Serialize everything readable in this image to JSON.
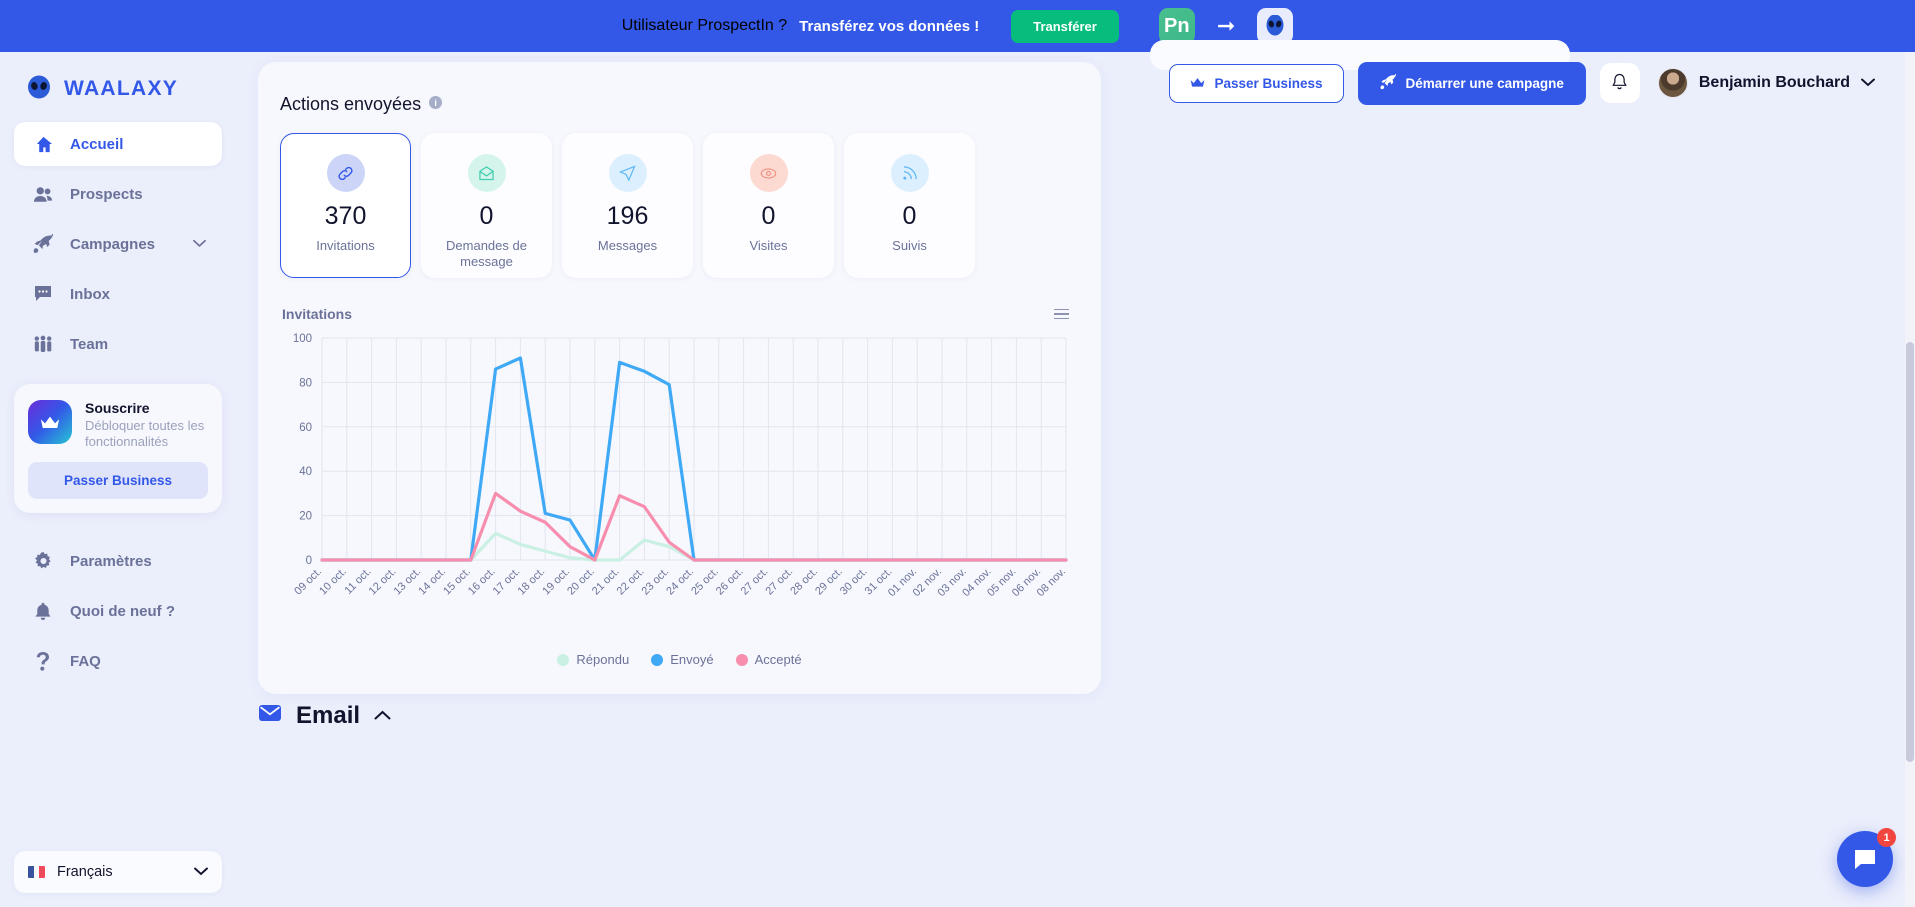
{
  "banner": {
    "title": "Utilisateur ProspectIn ?",
    "subtitle": "Transférez vos données !",
    "button": "Transférer",
    "pn_badge": "Pn",
    "arrow_icon": "arrow-right-icon",
    "alien_icon": "alien-icon",
    "close_icon": "close-icon"
  },
  "sidebar": {
    "brand": "WAALAXY",
    "brand_icon": "alien-logo-icon",
    "items": [
      {
        "label": "Accueil",
        "icon": "home-icon",
        "active": true,
        "chevron": ""
      },
      {
        "label": "Prospects",
        "icon": "users-icon",
        "active": false,
        "chevron": ""
      },
      {
        "label": "Campagnes",
        "icon": "rocket-icon",
        "active": false,
        "chevron": "⌄"
      },
      {
        "label": "Inbox",
        "icon": "chat-icon",
        "active": false,
        "chevron": ""
      },
      {
        "label": "Team",
        "icon": "team-icon",
        "active": false,
        "chevron": ""
      }
    ],
    "promo": {
      "icon": "crown-icon",
      "title": "Souscrire",
      "subtitle": "Débloquer toutes les fonctionnalités",
      "button": "Passer Business"
    },
    "bottom_items": [
      {
        "label": "Paramètres",
        "icon": "gear-icon"
      },
      {
        "label": "Quoi de neuf ?",
        "icon": "bell-icon"
      },
      {
        "label": "FAQ",
        "icon": "question-icon"
      }
    ],
    "language": {
      "label": "Français",
      "flag": "fr-flag-icon",
      "chevron": "⌄"
    }
  },
  "topbar": {
    "upgrade_button": "Passer Business",
    "upgrade_icon": "crown-icon",
    "campaign_button": "Démarrer une campagne",
    "campaign_icon": "rocket-icon",
    "bell_icon": "bell-icon",
    "user_name": "Benjamin Bouchard",
    "user_chevron": "⌄",
    "avatar": "user-avatar"
  },
  "main": {
    "section_title": "Actions envoyées",
    "info_icon": "info-icon",
    "cards": [
      {
        "value": "370",
        "label": "Invitations",
        "icon": "link-icon",
        "icon_bg": "#ccd5f8",
        "icon_color": "#3358e8",
        "selected": true
      },
      {
        "value": "0",
        "label": "Demandes de message",
        "icon": "mail-open-icon",
        "icon_bg": "#d5f5ec",
        "icon_color": "#3fcfae",
        "selected": false
      },
      {
        "value": "196",
        "label": "Messages",
        "icon": "paper-plane-icon",
        "icon_bg": "#dcefff",
        "icon_color": "#5fb8f5",
        "selected": false
      },
      {
        "value": "0",
        "label": "Visites",
        "icon": "eye-icon",
        "icon_bg": "#fcd9d1",
        "icon_color": "#f08e80",
        "selected": false
      },
      {
        "value": "0",
        "label": "Suivis",
        "icon": "rss-icon",
        "icon_bg": "#dcefff",
        "icon_color": "#5fb8f5",
        "selected": false
      }
    ],
    "chart_heading": "Invitations",
    "menu_icon": "hamburger-menu-icon",
    "email_section": {
      "icon": "email-icon",
      "title": "Email",
      "chevron": "⌃"
    }
  },
  "chat": {
    "icon": "chat-bubble-icon",
    "badge": "1"
  },
  "chart_data": {
    "type": "line",
    "title": "Invitations",
    "xlabel": "",
    "ylabel": "",
    "ylim": [
      0,
      100
    ],
    "yticks": [
      0,
      20,
      40,
      60,
      80,
      100
    ],
    "grid": true,
    "legend_position": "bottom",
    "categories": [
      "09 oct.",
      "10 oct.",
      "11 oct.",
      "12 oct.",
      "13 oct.",
      "14 oct.",
      "15 oct.",
      "16 oct.",
      "17 oct.",
      "18 oct.",
      "19 oct.",
      "20 oct.",
      "21 oct.",
      "22 oct.",
      "23 oct.",
      "24 oct.",
      "25 oct.",
      "26 oct.",
      "27 oct.",
      "27 oct.",
      "28 oct.",
      "29 oct.",
      "30 oct.",
      "31 oct.",
      "01 nov.",
      "02 nov.",
      "03 nov.",
      "04 nov.",
      "05 nov.",
      "06 nov.",
      "08 nov."
    ],
    "series": [
      {
        "name": "Répondu",
        "color": "#c9f0e2",
        "values": [
          0,
          0,
          0,
          0,
          0,
          0,
          0,
          12,
          7,
          4,
          1,
          0,
          0,
          9,
          6,
          0,
          0,
          0,
          0,
          0,
          0,
          0,
          0,
          0,
          0,
          0,
          0,
          0,
          0,
          0,
          0
        ]
      },
      {
        "name": "Envoyé",
        "color": "#3fa9f5",
        "values": [
          0,
          0,
          0,
          0,
          0,
          0,
          0,
          86,
          91,
          21,
          18,
          0,
          89,
          85,
          79,
          0,
          0,
          0,
          0,
          0,
          0,
          0,
          0,
          0,
          0,
          0,
          0,
          0,
          0,
          0,
          0
        ]
      },
      {
        "name": "Accepté",
        "color": "#f78eae",
        "values": [
          0,
          0,
          0,
          0,
          0,
          0,
          0,
          30,
          22,
          17,
          6,
          0,
          29,
          24,
          8,
          0,
          0,
          0,
          0,
          0,
          0,
          0,
          0,
          0,
          0,
          0,
          0,
          0,
          0,
          0,
          0
        ]
      }
    ]
  }
}
